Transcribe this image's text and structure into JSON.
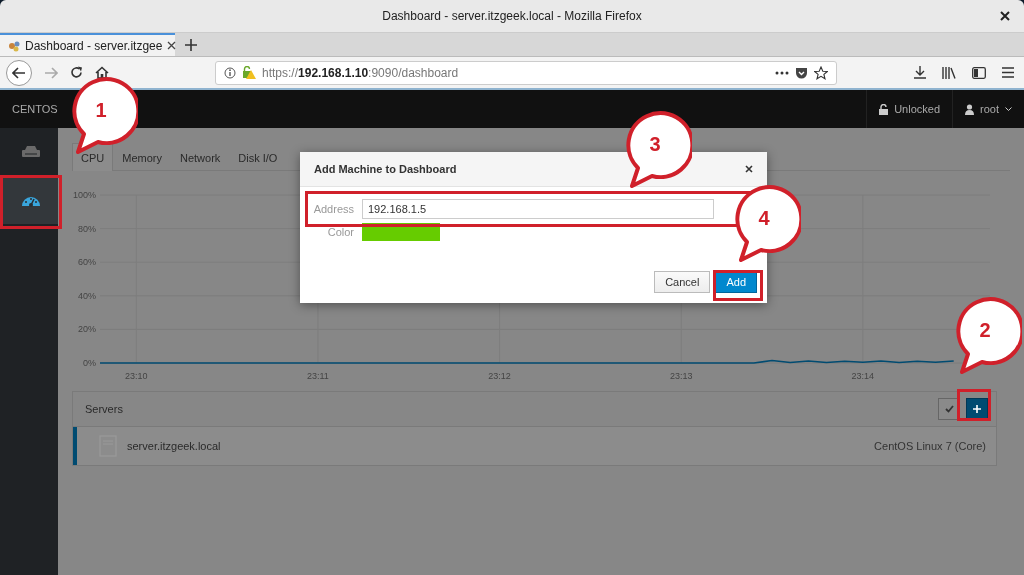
{
  "window": {
    "title": "Dashboard - server.itzgeek.local - Mozilla Firefox"
  },
  "browser": {
    "tabs": [
      {
        "title": "Dashboard - server.itzgee",
        "selected": true
      }
    ],
    "url": "https://**192.168.1.10**:9090/dashboard"
  },
  "cockpit": {
    "brand": "CENTOS",
    "lock_status": "Unlocked",
    "user": "root",
    "sidebar": [
      {
        "kind": "hosts",
        "selected": false
      },
      {
        "kind": "dashboard",
        "selected": true
      }
    ],
    "tabs": [
      {
        "label": "CPU",
        "selected": true
      },
      {
        "label": "Memory",
        "selected": false
      },
      {
        "label": "Network",
        "selected": false
      },
      {
        "label": "Disk I/O",
        "selected": false
      }
    ],
    "chart_data": {
      "type": "line",
      "categories": [
        null,
        null,
        "23:10",
        null,
        null,
        null,
        null,
        null,
        null,
        null,
        null,
        null,
        "23:11",
        null,
        null,
        null,
        null,
        null,
        null,
        null,
        null,
        null,
        "23:12",
        null,
        null,
        null,
        null,
        null,
        null,
        null,
        null,
        null,
        "23:13",
        null,
        null,
        null,
        null,
        null,
        null,
        null,
        null,
        null,
        "23:14",
        null,
        null,
        null,
        null,
        null,
        null,
        null
      ],
      "series": [
        {
          "color": "#004b71",
          "values": [
            0,
            0,
            0,
            0,
            0,
            0,
            0,
            0,
            0,
            0,
            0,
            0,
            0,
            0,
            0,
            0,
            0,
            0,
            0,
            0,
            0,
            0,
            0,
            0,
            0,
            0,
            0,
            0,
            0,
            0,
            0,
            0,
            0,
            0,
            0,
            0,
            0,
            1.5,
            0.3,
            1.2,
            0.3,
            1.1,
            0.4,
            1.2,
            0.3,
            1.1,
            0.4,
            1.2,
            null,
            null
          ]
        }
      ],
      "grid": true,
      "ylim": [
        0,
        100
      ],
      "yticks": [
        {
          "value": 0,
          "label": "0%"
        },
        {
          "value": 20,
          "label": "20%"
        },
        {
          "value": 40,
          "label": "40%"
        },
        {
          "value": 60,
          "label": "60%"
        },
        {
          "value": 80,
          "label": "80%"
        },
        {
          "value": 100,
          "label": "100%"
        }
      ]
    },
    "servers": {
      "title": "Servers",
      "rows": [
        {
          "name": "server.itzgeek.local",
          "os": "CentOS Linux 7 (Core)",
          "color": "#004b71"
        }
      ]
    }
  },
  "dialog": {
    "title": "Add Machine to Dashboard",
    "fields": [
      {
        "kind": "text",
        "label": "Address",
        "value": "192.168.1.5"
      },
      {
        "kind": "color",
        "label": "Color",
        "color": "#66cc00"
      }
    ],
    "buttons": [
      {
        "label": "Cancel",
        "kind": "default"
      },
      {
        "label": "Add",
        "kind": "primary"
      }
    ]
  },
  "annotations": [
    {
      "label": "1"
    },
    {
      "label": "2"
    },
    {
      "label": "3"
    },
    {
      "label": "4"
    }
  ]
}
